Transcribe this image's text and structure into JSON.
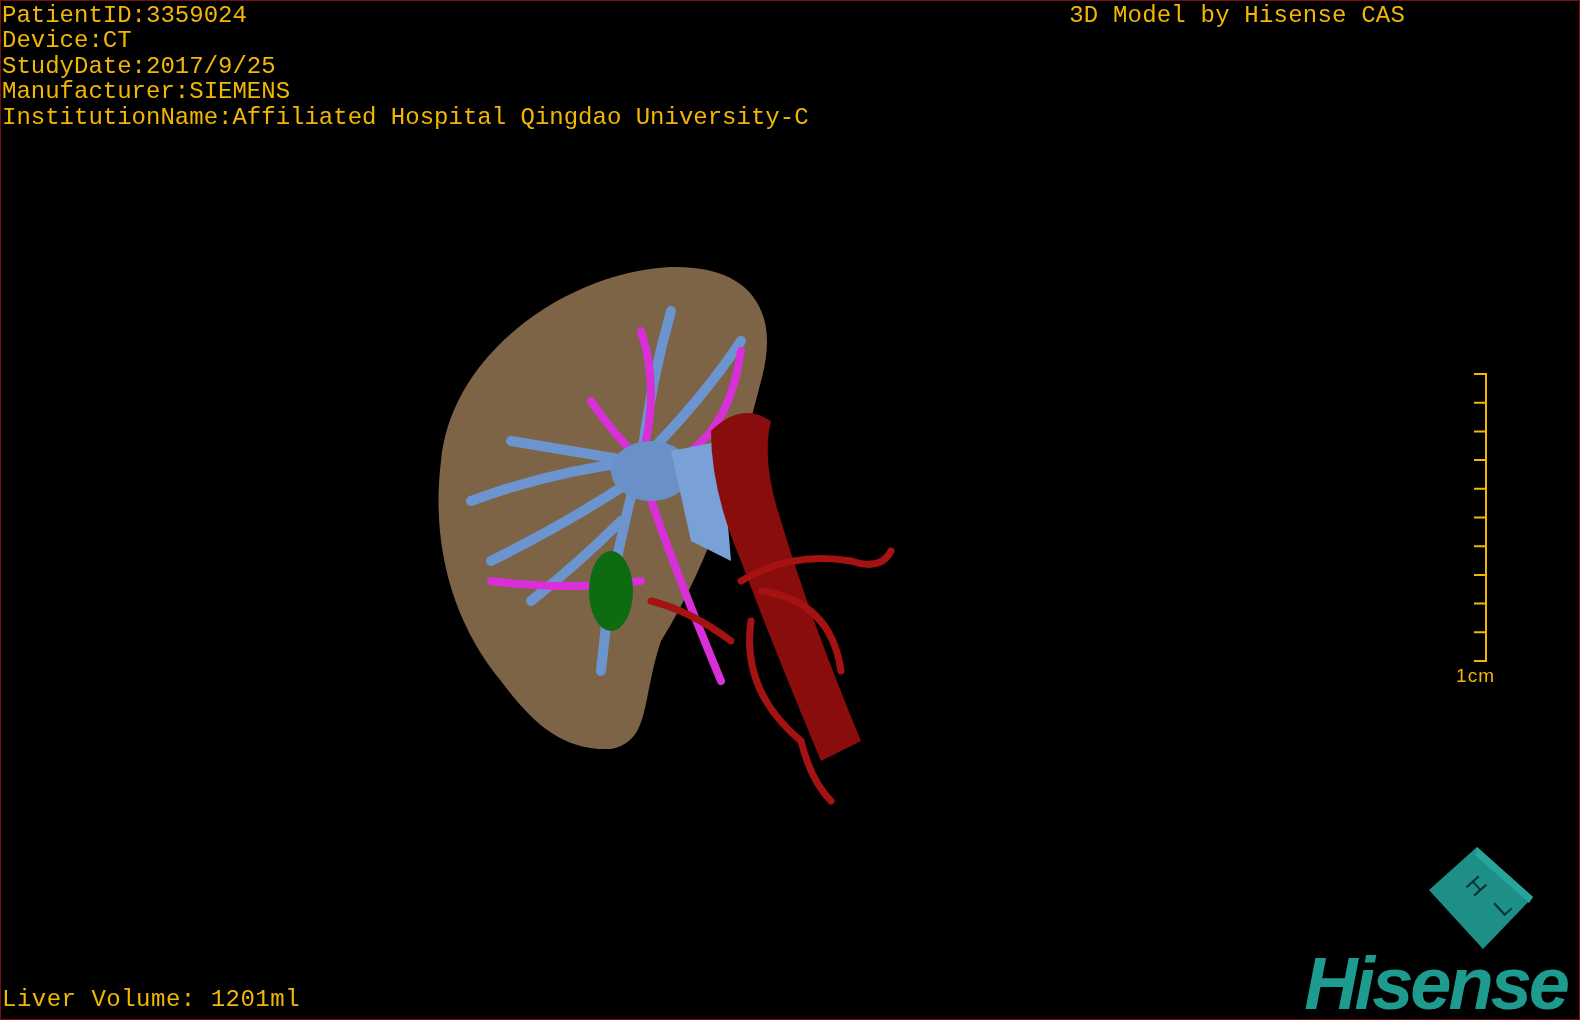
{
  "patient_info": [
    "PatientID:3359024",
    "Device:CT",
    "StudyDate:2017/9/25",
    "Manufacturer:SIEMENS",
    "InstitutionName:Affiliated Hospital Qingdao University-C"
  ],
  "title": "3D Model by Hisense CAS",
  "scale_bar": {
    "label": "1cm"
  },
  "orientation_cube": {
    "labels": [
      "H",
      "L"
    ]
  },
  "logo": {
    "text": "Hisense"
  },
  "liver_volume": "Liver Volume: 1201ml"
}
